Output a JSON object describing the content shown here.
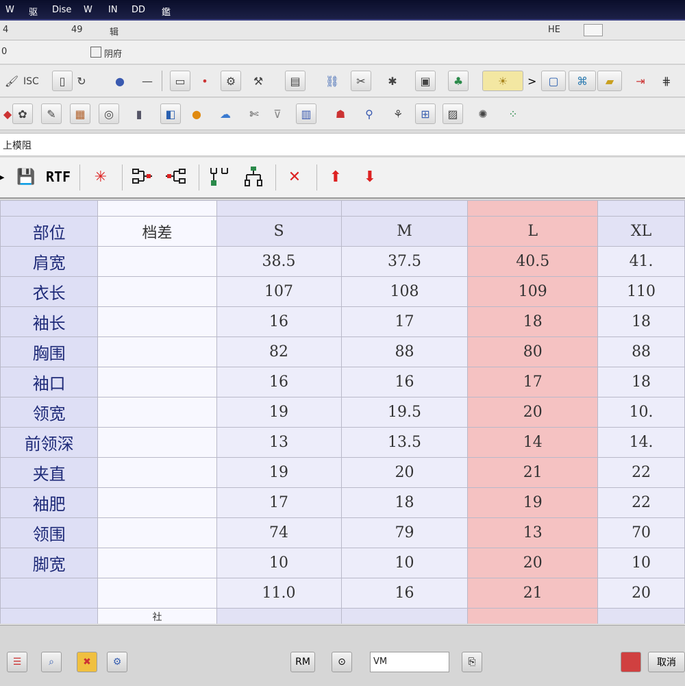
{
  "titlebar": {
    "items": [
      "W",
      "驱",
      "Dise",
      "W",
      "IN",
      "DD",
      "鑑"
    ]
  },
  "menubar": {
    "items": [
      "4",
      "49",
      "辑",
      "HE"
    ]
  },
  "strip": {
    "items": [
      "0",
      "阴府"
    ]
  },
  "toolbar1": {
    "label": "ISC"
  },
  "address_bar": {
    "value": "上模阻"
  },
  "format_toolbar": {
    "save_icon": "💾",
    "rtf_label": "RTF",
    "star_icon": "✳",
    "delete_icon": "✕",
    "up_icon": "⬆",
    "down_icon": "⬇"
  },
  "size_table": {
    "top_row": [
      "",
      "",
      "",
      "",
      "",
      ""
    ],
    "header": [
      "部位",
      "档差",
      "S",
      "M",
      "L",
      "XL"
    ],
    "rows": [
      {
        "name": "肩宽",
        "diff": "",
        "s": "38.5",
        "m": "37.5",
        "l": "40.5",
        "xl": "41."
      },
      {
        "name": "衣长",
        "diff": "",
        "s": "107",
        "m": "108",
        "l": "109",
        "xl": "110"
      },
      {
        "name": "袖长",
        "diff": "",
        "s": "16",
        "m": "17",
        "l": "18",
        "xl": "18"
      },
      {
        "name": "胸围",
        "diff": "",
        "s": "82",
        "m": "88",
        "l": "80",
        "xl": "88"
      },
      {
        "name": "袖口",
        "diff": "",
        "s": "16",
        "m": "16",
        "l": "17",
        "xl": "18"
      },
      {
        "name": "领宽",
        "diff": "",
        "s": "19",
        "m": "19.5",
        "l": "20",
        "xl": "10."
      },
      {
        "name": "前领深",
        "diff": "",
        "s": "13",
        "m": "13.5",
        "l": "14",
        "xl": "14."
      },
      {
        "name": "夹直",
        "diff": "",
        "s": "19",
        "m": "20",
        "l": "21",
        "xl": "22"
      },
      {
        "name": "袖肥",
        "diff": "",
        "s": "17",
        "m": "18",
        "l": "19",
        "xl": "22"
      },
      {
        "name": "领围",
        "diff": "",
        "s": "74",
        "m": "79",
        "l": "13",
        "xl": "70"
      },
      {
        "name": "脚宽",
        "diff": "",
        "s": "10",
        "m": "10",
        "l": "20",
        "xl": "10"
      },
      {
        "name": "",
        "diff": "",
        "s": "11.0",
        "m": "16",
        "l": "21",
        "xl": "20"
      }
    ],
    "bottom_row": [
      "",
      "社",
      "",
      "",
      "",
      ""
    ],
    "highlight_color": "#f5c2c2"
  },
  "statusbar": {
    "mid_label": "RM",
    "field_value": "VM",
    "right_label": "取消"
  }
}
